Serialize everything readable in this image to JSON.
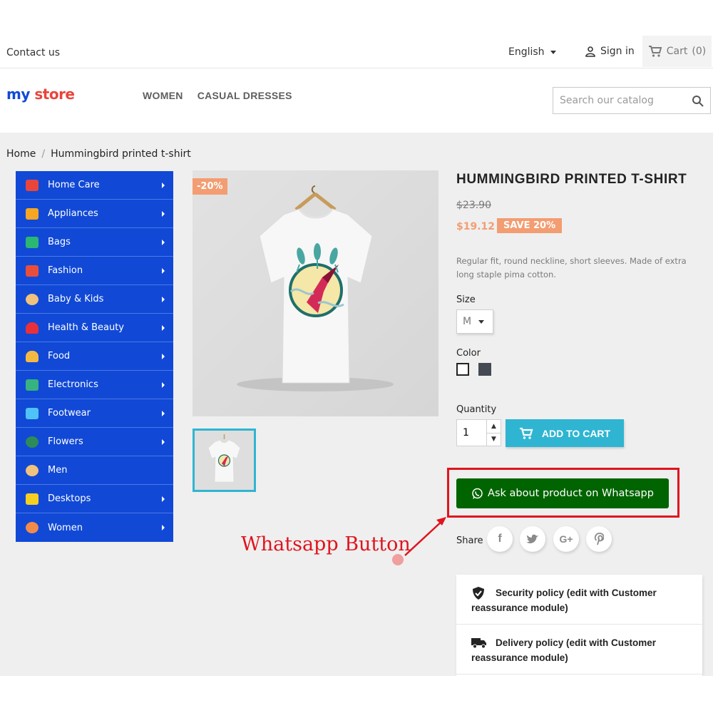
{
  "topbar": {
    "contact_label": "Contact us",
    "language_label": "English",
    "signin_label": "Sign in",
    "cart_label": "Cart",
    "cart_count": "(0)"
  },
  "header": {
    "logo": {
      "word1": "my",
      "word2": "store"
    },
    "nav": [
      "WOMEN",
      "CASUAL DRESSES"
    ],
    "search_placeholder": "Search our catalog"
  },
  "breadcrumb": {
    "home": "Home",
    "separator": "/",
    "current": "Hummingbird printed t-shirt"
  },
  "sidebar": {
    "items": [
      {
        "label": "Home Care",
        "icon": "home-care-icon",
        "color": "#e8453c",
        "arrow": true
      },
      {
        "label": "Appliances",
        "icon": "appliances-icon",
        "color": "#f5a623",
        "arrow": true
      },
      {
        "label": "Bags",
        "icon": "bags-icon",
        "color": "#2bb673",
        "arrow": true
      },
      {
        "label": "Fashion",
        "icon": "fashion-icon",
        "color": "#e94e3c",
        "arrow": true
      },
      {
        "label": "Baby & Kids",
        "icon": "baby-icon",
        "color": "#f1c27d",
        "arrow": true
      },
      {
        "label": "Health & Beauty",
        "icon": "heart-icon",
        "color": "#e8303a",
        "arrow": true
      },
      {
        "label": "Food",
        "icon": "burger-icon",
        "color": "#f4b942",
        "arrow": true
      },
      {
        "label": "Electronics",
        "icon": "electronics-icon",
        "color": "#36b37e",
        "arrow": true
      },
      {
        "label": "Footwear",
        "icon": "shoe-icon",
        "color": "#4fc3f7",
        "arrow": true
      },
      {
        "label": "Flowers",
        "icon": "flower-icon",
        "color": "#2e8b57",
        "arrow": true
      },
      {
        "label": "Men",
        "icon": "man-icon",
        "color": "#f1c27d",
        "arrow": false
      },
      {
        "label": "Desktops",
        "icon": "desktop-icon",
        "color": "#f5d020",
        "arrow": true
      },
      {
        "label": "Women",
        "icon": "woman-icon",
        "color": "#f28b4a",
        "arrow": true
      }
    ]
  },
  "product": {
    "discount_badge": "-20%",
    "title": "HUMMINGBIRD PRINTED T-SHIRT",
    "old_price": "$23.90",
    "price": "$19.12",
    "save_badge": "SAVE 20%",
    "description": "Regular fit, round neckline, short sleeves. Made of extra long staple pima cotton.",
    "size_label": "Size",
    "size_value": "M",
    "color_label": "Color",
    "colors": [
      "#ffffff",
      "#434a54"
    ],
    "quantity_label": "Quantity",
    "quantity_value": "1",
    "add_to_cart_label": "ADD TO CART",
    "whatsapp_label": "Ask about product on Whatsapp",
    "share_label": "Share",
    "share_networks": [
      "facebook",
      "twitter",
      "google-plus",
      "pinterest"
    ]
  },
  "annotation": {
    "label": "Whatsapp Button",
    "color": "#e0141e"
  },
  "reassurance": [
    {
      "icon": "shield-check-icon",
      "text": "Security policy (edit with Customer reassurance module)"
    },
    {
      "icon": "truck-icon",
      "text": "Delivery policy (edit with Customer reassurance module)"
    }
  ],
  "colors": {
    "sidebar_bg": "#1149d6",
    "accent": "#2fb5d2",
    "sale": "#f39d72",
    "whatsapp": "#006400"
  }
}
